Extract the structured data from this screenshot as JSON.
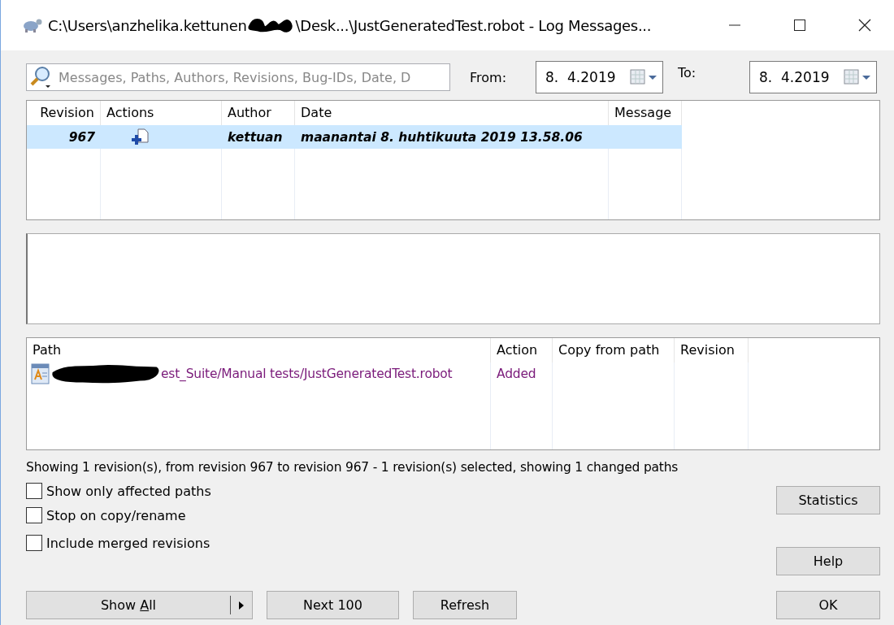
{
  "window": {
    "title_start": "C:\\Users\\anzhelika.kettunen",
    "title_end": "\\Desk...\\JustGeneratedTest.robot - Log Messages..."
  },
  "search": {
    "placeholder": "Messages, Paths, Authors, Revisions, Bug-IDs, Date, D"
  },
  "from": {
    "label": "From:",
    "value": "8.  4.2019"
  },
  "to": {
    "label": "To:",
    "value": "8.  4.2019"
  },
  "revisions": {
    "columns": [
      "Revision",
      "Actions",
      "Author",
      "Date",
      "Message"
    ],
    "rows": [
      {
        "revision": "967",
        "author": "kettuan",
        "date": "maanantai 8. huhtikuuta 2019 13.58.06",
        "selected": true
      }
    ]
  },
  "paths": {
    "columns": [
      "Path",
      "Action",
      "Copy from path",
      "Revision"
    ],
    "rows": [
      {
        "path": "est_Suite/Manual tests/JustGeneratedTest.robot",
        "action": "Added"
      }
    ]
  },
  "status": "Showing 1 revision(s), from revision 967 to revision 967 - 1 revision(s) selected, showing 1 changed paths",
  "options": [
    {
      "label": "Show only affected paths",
      "checked": false
    },
    {
      "label": "Stop on copy/rename",
      "checked": false
    },
    {
      "label": "Include merged revisions",
      "checked": false
    }
  ],
  "buttons": {
    "statistics": "Statistics",
    "help": "Help",
    "show_all": {
      "label_before": "Show ",
      "mnemonic": "A",
      "label_after": "ll"
    },
    "next": "Next 100",
    "refresh": "Refresh",
    "ok": "OK"
  }
}
